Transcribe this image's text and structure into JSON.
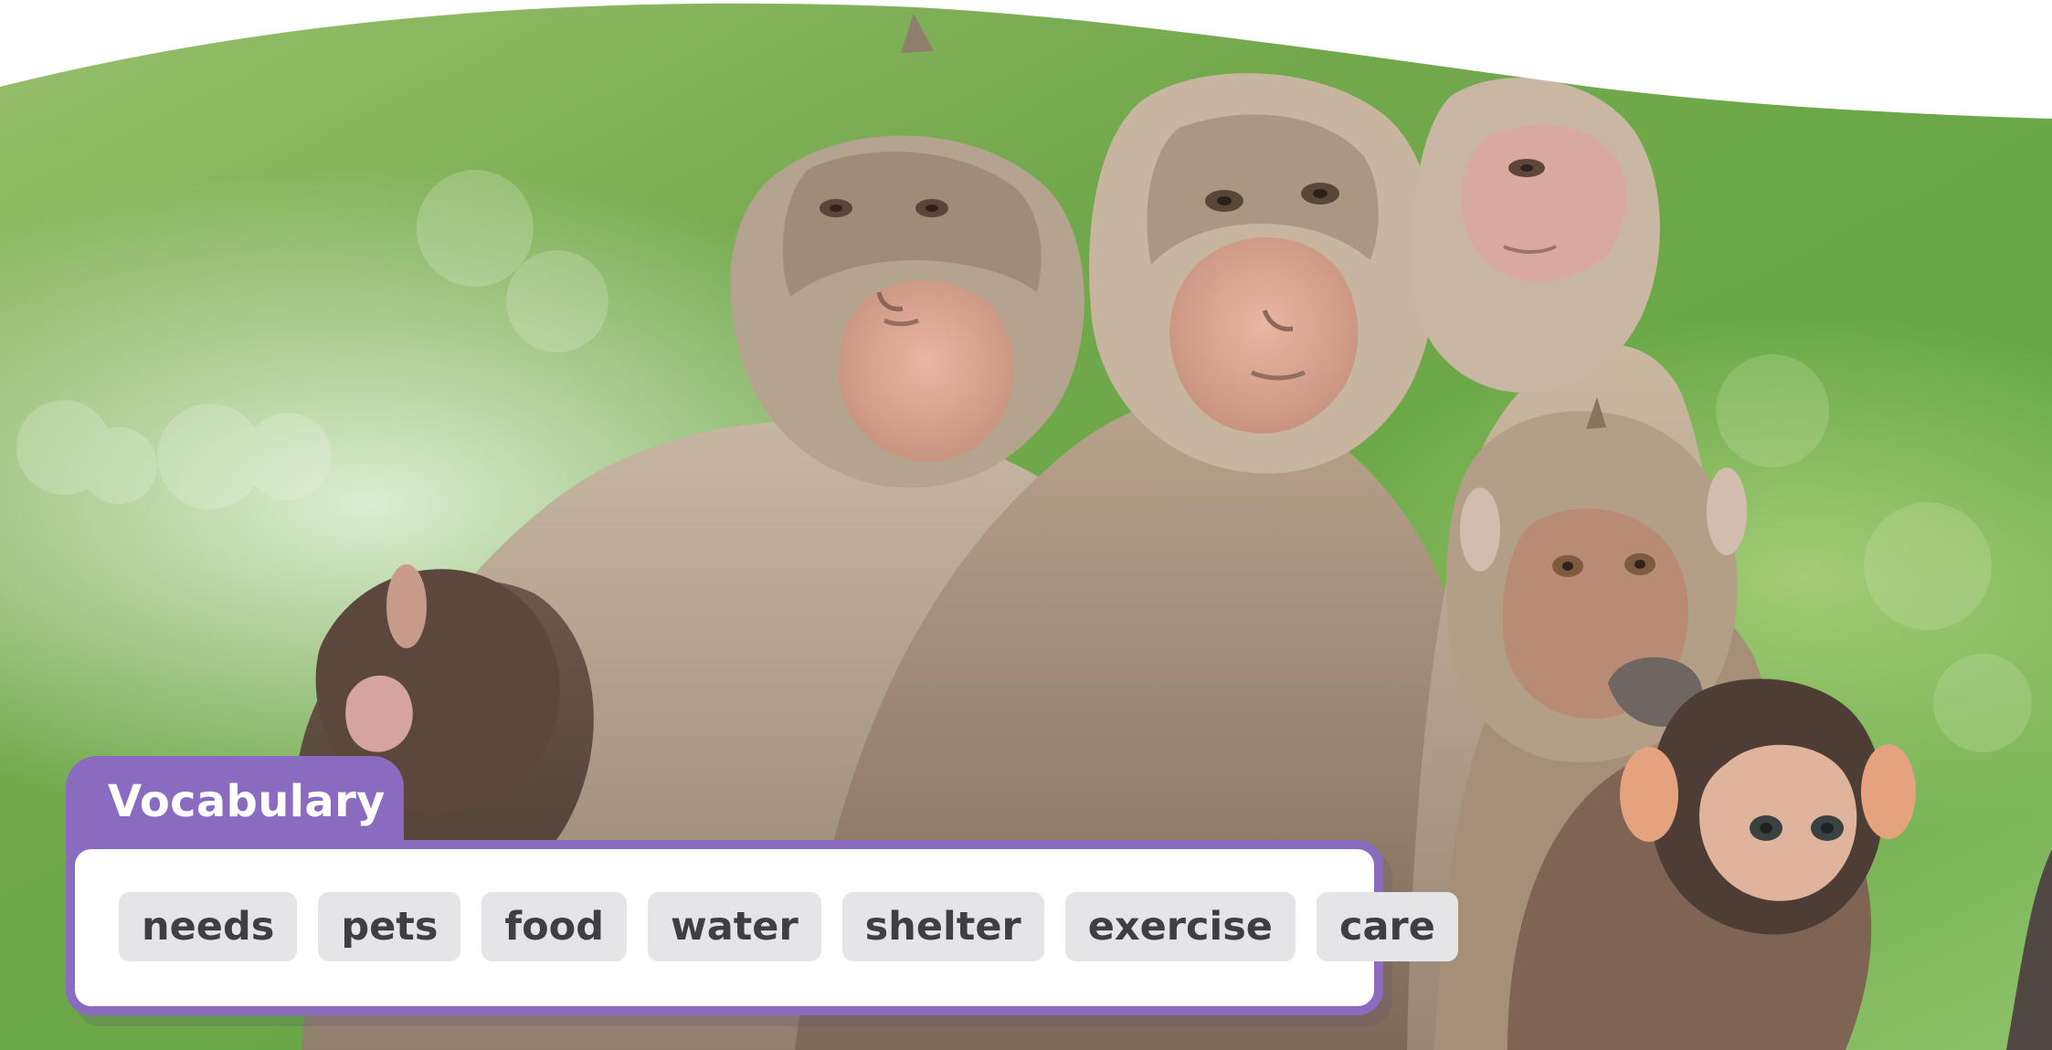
{
  "vocabulary": {
    "title": "Vocabulary",
    "words": [
      "needs",
      "pets",
      "food",
      "water",
      "shelter",
      "exercise",
      "care"
    ]
  },
  "theme": {
    "accent": "#8a6bbf",
    "chip_background": "#e5e5e7",
    "chip_text": "#3f3f43",
    "header_text": "#ffffff"
  }
}
